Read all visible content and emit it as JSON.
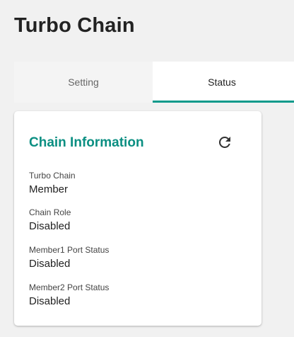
{
  "page": {
    "title": "Turbo Chain"
  },
  "tabs": [
    {
      "label": "Setting",
      "active": false
    },
    {
      "label": "Status",
      "active": true
    }
  ],
  "card": {
    "title": "Chain Information",
    "refresh_icon": "refresh-icon",
    "fields": [
      {
        "label": "Turbo Chain",
        "value": "Member"
      },
      {
        "label": "Chain Role",
        "value": "Disabled"
      },
      {
        "label": "Member1 Port Status",
        "value": "Disabled"
      },
      {
        "label": "Member2 Port Status",
        "value": "Disabled"
      }
    ]
  },
  "colors": {
    "accent": "#0b9a8b",
    "title_accent": "#0b8f82",
    "background": "#f1f1f1",
    "card": "#ffffff"
  }
}
